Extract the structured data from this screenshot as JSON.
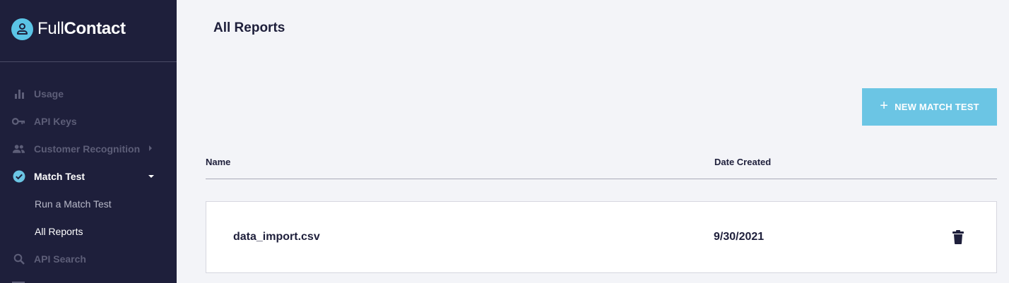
{
  "brand": {
    "name_light": "Full",
    "name_bold": "Contact"
  },
  "sidebar": {
    "items": [
      {
        "label": "Usage",
        "icon": "bar-chart-icon"
      },
      {
        "label": "API Keys",
        "icon": "key-icon"
      },
      {
        "label": "Customer Recognition",
        "icon": "people-icon"
      },
      {
        "label": "Match Test",
        "icon": "check-circle-icon"
      },
      {
        "label": "Run a Match Test"
      },
      {
        "label": "All Reports"
      },
      {
        "label": "API Search",
        "icon": "search-icon"
      }
    ]
  },
  "main": {
    "title": "All Reports",
    "new_button": {
      "label": "NEW MATCH TEST",
      "icon": "plus-icon"
    },
    "table": {
      "columns": [
        "Name",
        "Date Created"
      ],
      "rows": [
        {
          "name": "data_import.csv",
          "date": "9/30/2021"
        }
      ]
    }
  },
  "colors": {
    "sidebar_bg": "#1e1f3b",
    "accent": "#6bc5e4",
    "page_bg": "#f3f4f8"
  }
}
